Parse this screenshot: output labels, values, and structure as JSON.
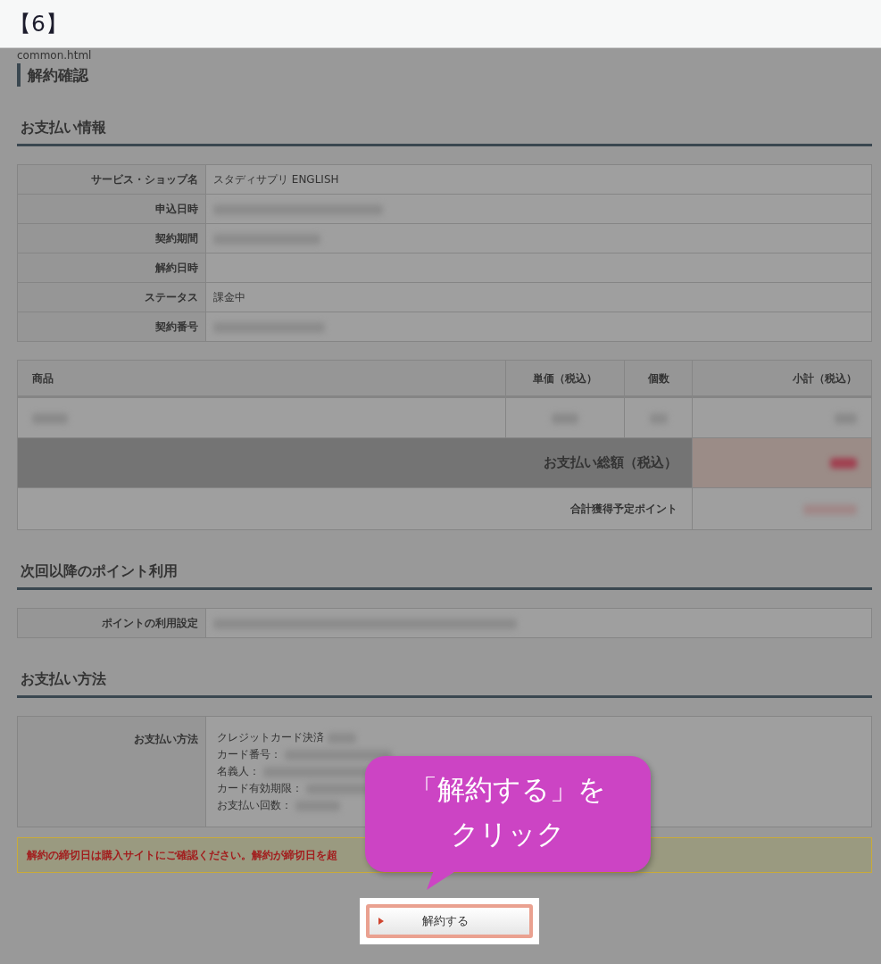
{
  "step_label": "【6】",
  "file_name": "common.html",
  "page_title": "解約確認",
  "payment_info": {
    "heading": "お支払い情報",
    "rows": [
      {
        "label": "サービス・ショップ名",
        "value": "スタディサプリ ENGLISH",
        "blurred": false
      },
      {
        "label": "申込日時",
        "blurred": true
      },
      {
        "label": "契約期間",
        "blurred": true
      },
      {
        "label": "解約日時",
        "blurred": false
      },
      {
        "label": "ステータス",
        "value": "課金中",
        "blurred": false
      },
      {
        "label": "契約番号",
        "blurred": true
      }
    ]
  },
  "order_table": {
    "columns": [
      {
        "label": "商品"
      },
      {
        "label": "単価（税込）"
      },
      {
        "label": "個数"
      },
      {
        "label": "小計（税込）"
      }
    ],
    "rows": [
      {
        "cells": [
          {
            "blurred": true
          },
          {
            "blurred": true
          },
          {
            "blurred": true
          },
          {
            "blurred": true
          }
        ]
      }
    ],
    "total": {
      "label": "お支払い総額（税込）",
      "blurred": true
    },
    "points": {
      "label": "合計獲得予定ポイント",
      "blurred": true
    }
  },
  "point_usage": {
    "heading": "次回以降のポイント利用",
    "rows": [
      {
        "label": "ポイントの利用設定",
        "blurred": true
      }
    ]
  },
  "payment_method": {
    "heading": "お支払い方法",
    "label": "お支払い方法",
    "lines": [
      {
        "text": "クレジットカード決済",
        "blurred": true
      },
      {
        "text": "カード番号：",
        "blurred": true
      },
      {
        "text": "名義人：",
        "blurred": true
      },
      {
        "text": "カード有効期限：",
        "blurred": true
      },
      {
        "text": "お支払い回数：",
        "blurred": true
      }
    ]
  },
  "notice": {
    "text": "解約の締切日は購入サイトにご確認ください。解約が締切日を超"
  },
  "cancel_button": {
    "label": "解約する"
  },
  "callout": {
    "lines": [
      "「解約する」を",
      "クリック"
    ]
  }
}
